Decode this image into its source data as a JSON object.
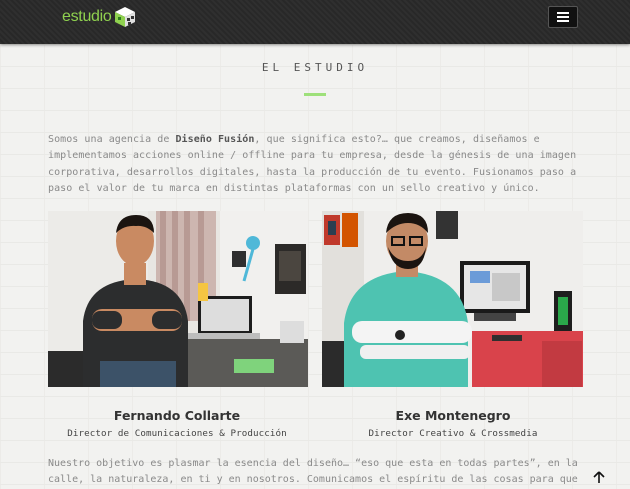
{
  "header": {
    "logo_text": "estudio",
    "menu_icon": "hamburger-menu-icon"
  },
  "section": {
    "title": "EL ESTUDIO"
  },
  "intro": {
    "part1": "Somos una agencia de ",
    "bold": "Diseño Fusión",
    "part2": ", que significa esto?… que creamos, diseñamos e implementamos acciones online / offline para tu empresa, desde la génesis de una imagen corporativa, desarrollos digitales, hasta la producción de tu evento. Fusionamos paso a paso el valor de tu marca en distintas plataformas con un sello creativo y único."
  },
  "team": [
    {
      "name": "Fernando Collarte",
      "role": "Director de Comunicaciones & Producción"
    },
    {
      "name": "Exe Montenegro",
      "role": "Director Creativo & Crossmedia"
    }
  ],
  "outro": {
    "line1": "Nuestro objetivo es plasmar la esencia del diseño… “eso que esta en todas partes”, en la",
    "line2": "calle, la naturaleza, en ti y en nosotros. Comunicamos el espíritu de las cosas para que"
  },
  "colors": {
    "accent": "#8fd14f",
    "topbar": "#2b2b2b"
  }
}
